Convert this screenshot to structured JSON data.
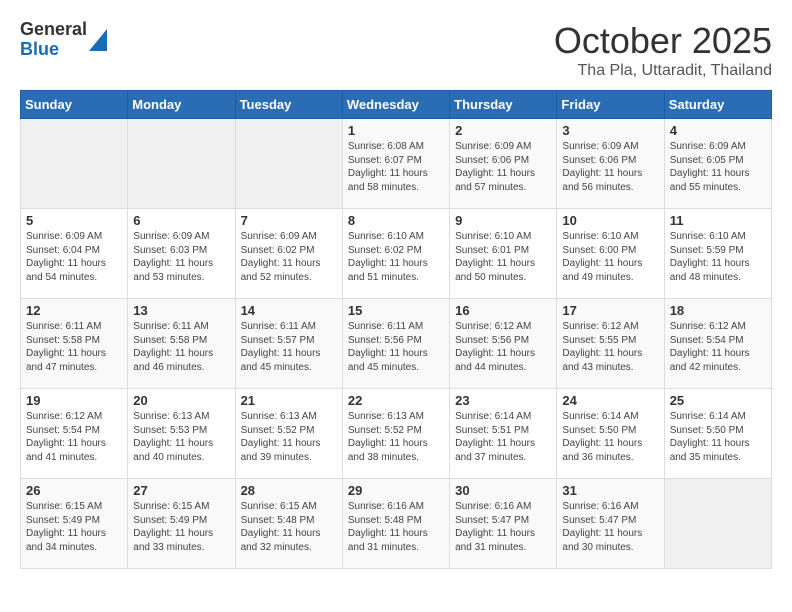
{
  "header": {
    "logo_general": "General",
    "logo_blue": "Blue",
    "month_title": "October 2025",
    "location": "Tha Pla, Uttaradit, Thailand"
  },
  "days_of_week": [
    "Sunday",
    "Monday",
    "Tuesday",
    "Wednesday",
    "Thursday",
    "Friday",
    "Saturday"
  ],
  "weeks": [
    [
      {
        "day": "",
        "sunrise": "",
        "sunset": "",
        "daylight": ""
      },
      {
        "day": "",
        "sunrise": "",
        "sunset": "",
        "daylight": ""
      },
      {
        "day": "",
        "sunrise": "",
        "sunset": "",
        "daylight": ""
      },
      {
        "day": "1",
        "sunrise": "Sunrise: 6:08 AM",
        "sunset": "Sunset: 6:07 PM",
        "daylight": "Daylight: 11 hours and 58 minutes."
      },
      {
        "day": "2",
        "sunrise": "Sunrise: 6:09 AM",
        "sunset": "Sunset: 6:06 PM",
        "daylight": "Daylight: 11 hours and 57 minutes."
      },
      {
        "day": "3",
        "sunrise": "Sunrise: 6:09 AM",
        "sunset": "Sunset: 6:06 PM",
        "daylight": "Daylight: 11 hours and 56 minutes."
      },
      {
        "day": "4",
        "sunrise": "Sunrise: 6:09 AM",
        "sunset": "Sunset: 6:05 PM",
        "daylight": "Daylight: 11 hours and 55 minutes."
      }
    ],
    [
      {
        "day": "5",
        "sunrise": "Sunrise: 6:09 AM",
        "sunset": "Sunset: 6:04 PM",
        "daylight": "Daylight: 11 hours and 54 minutes."
      },
      {
        "day": "6",
        "sunrise": "Sunrise: 6:09 AM",
        "sunset": "Sunset: 6:03 PM",
        "daylight": "Daylight: 11 hours and 53 minutes."
      },
      {
        "day": "7",
        "sunrise": "Sunrise: 6:09 AM",
        "sunset": "Sunset: 6:02 PM",
        "daylight": "Daylight: 11 hours and 52 minutes."
      },
      {
        "day": "8",
        "sunrise": "Sunrise: 6:10 AM",
        "sunset": "Sunset: 6:02 PM",
        "daylight": "Daylight: 11 hours and 51 minutes."
      },
      {
        "day": "9",
        "sunrise": "Sunrise: 6:10 AM",
        "sunset": "Sunset: 6:01 PM",
        "daylight": "Daylight: 11 hours and 50 minutes."
      },
      {
        "day": "10",
        "sunrise": "Sunrise: 6:10 AM",
        "sunset": "Sunset: 6:00 PM",
        "daylight": "Daylight: 11 hours and 49 minutes."
      },
      {
        "day": "11",
        "sunrise": "Sunrise: 6:10 AM",
        "sunset": "Sunset: 5:59 PM",
        "daylight": "Daylight: 11 hours and 48 minutes."
      }
    ],
    [
      {
        "day": "12",
        "sunrise": "Sunrise: 6:11 AM",
        "sunset": "Sunset: 5:58 PM",
        "daylight": "Daylight: 11 hours and 47 minutes."
      },
      {
        "day": "13",
        "sunrise": "Sunrise: 6:11 AM",
        "sunset": "Sunset: 5:58 PM",
        "daylight": "Daylight: 11 hours and 46 minutes."
      },
      {
        "day": "14",
        "sunrise": "Sunrise: 6:11 AM",
        "sunset": "Sunset: 5:57 PM",
        "daylight": "Daylight: 11 hours and 45 minutes."
      },
      {
        "day": "15",
        "sunrise": "Sunrise: 6:11 AM",
        "sunset": "Sunset: 5:56 PM",
        "daylight": "Daylight: 11 hours and 45 minutes."
      },
      {
        "day": "16",
        "sunrise": "Sunrise: 6:12 AM",
        "sunset": "Sunset: 5:56 PM",
        "daylight": "Daylight: 11 hours and 44 minutes."
      },
      {
        "day": "17",
        "sunrise": "Sunrise: 6:12 AM",
        "sunset": "Sunset: 5:55 PM",
        "daylight": "Daylight: 11 hours and 43 minutes."
      },
      {
        "day": "18",
        "sunrise": "Sunrise: 6:12 AM",
        "sunset": "Sunset: 5:54 PM",
        "daylight": "Daylight: 11 hours and 42 minutes."
      }
    ],
    [
      {
        "day": "19",
        "sunrise": "Sunrise: 6:12 AM",
        "sunset": "Sunset: 5:54 PM",
        "daylight": "Daylight: 11 hours and 41 minutes."
      },
      {
        "day": "20",
        "sunrise": "Sunrise: 6:13 AM",
        "sunset": "Sunset: 5:53 PM",
        "daylight": "Daylight: 11 hours and 40 minutes."
      },
      {
        "day": "21",
        "sunrise": "Sunrise: 6:13 AM",
        "sunset": "Sunset: 5:52 PM",
        "daylight": "Daylight: 11 hours and 39 minutes."
      },
      {
        "day": "22",
        "sunrise": "Sunrise: 6:13 AM",
        "sunset": "Sunset: 5:52 PM",
        "daylight": "Daylight: 11 hours and 38 minutes."
      },
      {
        "day": "23",
        "sunrise": "Sunrise: 6:14 AM",
        "sunset": "Sunset: 5:51 PM",
        "daylight": "Daylight: 11 hours and 37 minutes."
      },
      {
        "day": "24",
        "sunrise": "Sunrise: 6:14 AM",
        "sunset": "Sunset: 5:50 PM",
        "daylight": "Daylight: 11 hours and 36 minutes."
      },
      {
        "day": "25",
        "sunrise": "Sunrise: 6:14 AM",
        "sunset": "Sunset: 5:50 PM",
        "daylight": "Daylight: 11 hours and 35 minutes."
      }
    ],
    [
      {
        "day": "26",
        "sunrise": "Sunrise: 6:15 AM",
        "sunset": "Sunset: 5:49 PM",
        "daylight": "Daylight: 11 hours and 34 minutes."
      },
      {
        "day": "27",
        "sunrise": "Sunrise: 6:15 AM",
        "sunset": "Sunset: 5:49 PM",
        "daylight": "Daylight: 11 hours and 33 minutes."
      },
      {
        "day": "28",
        "sunrise": "Sunrise: 6:15 AM",
        "sunset": "Sunset: 5:48 PM",
        "daylight": "Daylight: 11 hours and 32 minutes."
      },
      {
        "day": "29",
        "sunrise": "Sunrise: 6:16 AM",
        "sunset": "Sunset: 5:48 PM",
        "daylight": "Daylight: 11 hours and 31 minutes."
      },
      {
        "day": "30",
        "sunrise": "Sunrise: 6:16 AM",
        "sunset": "Sunset: 5:47 PM",
        "daylight": "Daylight: 11 hours and 31 minutes."
      },
      {
        "day": "31",
        "sunrise": "Sunrise: 6:16 AM",
        "sunset": "Sunset: 5:47 PM",
        "daylight": "Daylight: 11 hours and 30 minutes."
      },
      {
        "day": "",
        "sunrise": "",
        "sunset": "",
        "daylight": ""
      }
    ]
  ]
}
